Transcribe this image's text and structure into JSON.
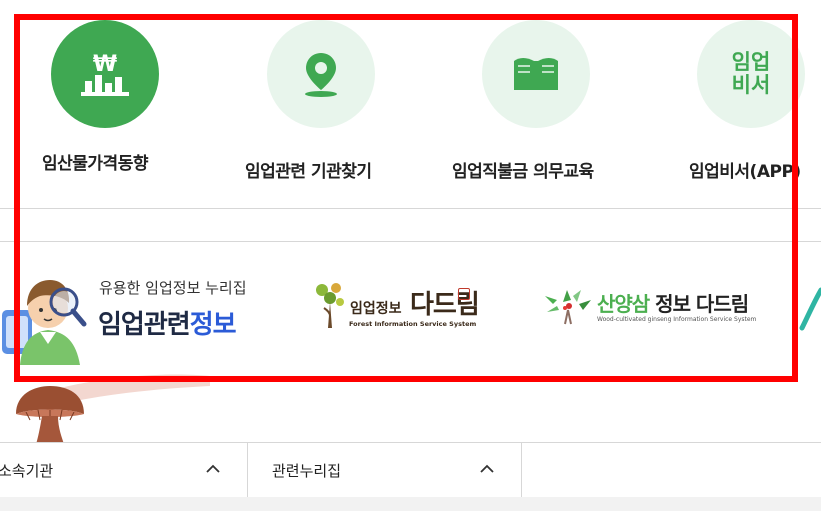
{
  "quick_menu": [
    {
      "label": "임산물가격동향",
      "icon": "price-chart-icon",
      "active": true
    },
    {
      "label": "임업관련 기관찾기",
      "icon": "location-pin-icon",
      "active": false
    },
    {
      "label": "임업직불금 의무교육",
      "icon": "open-book-icon",
      "active": false
    },
    {
      "label": "임업비서(APP)",
      "icon": "forestry-secretary-app-icon",
      "icon_text_line1": "임업",
      "icon_text_line2": "비서",
      "active": false
    }
  ],
  "banners": [
    {
      "subtitle": "유용한 임업정보 누리집",
      "title_part1": "임업관련",
      "title_part2": "정보",
      "icon": "character-with-magnifier-icon"
    },
    {
      "title_part1": "임업정보",
      "title_part2": "다드림",
      "subtitle": "Forest Information Service System",
      "icon": "tree-logo-icon"
    },
    {
      "title_part1": "산양삼",
      "title_part2": "정보 다드림",
      "subtitle": "Wood-cultivated ginseng Information Service System",
      "icon": "ginseng-logo-icon"
    }
  ],
  "footer": [
    {
      "label": "소속기관",
      "icon": "chevron-up-icon"
    },
    {
      "label": "관련누리집",
      "icon": "chevron-up-icon"
    }
  ],
  "colors": {
    "brand_green": "#3fa852",
    "light_green": "#e8f5ec",
    "highlight": "#ff0000",
    "title_blue": "#2b5bd7"
  }
}
